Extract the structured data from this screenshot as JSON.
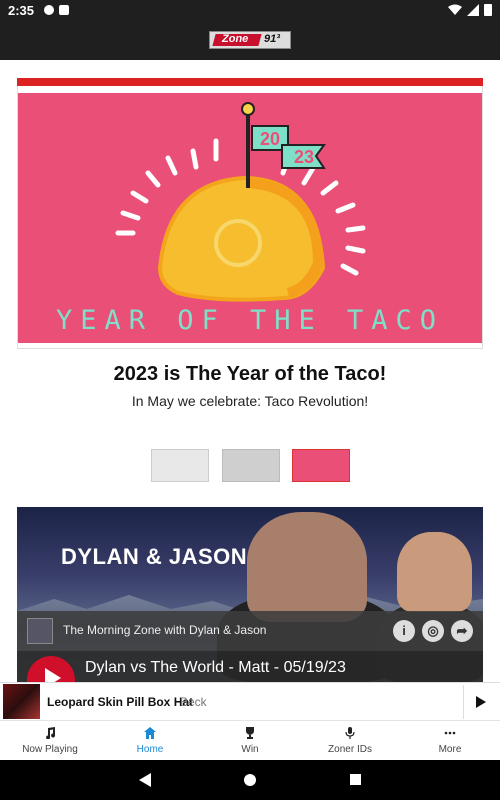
{
  "status_bar": {
    "time": "2:35"
  },
  "app": {
    "logo_text": "Zone",
    "logo_frequency": "91³"
  },
  "hero": {
    "flag_year_top": "20",
    "flag_year_bottom": "23",
    "banner_text": "YEAR OF THE TACO",
    "title": "2023 is The Year of the Taco!",
    "subtitle": "In May we celebrate: Taco Revolution!"
  },
  "carousel": {
    "thumbs": [
      "thumb-1",
      "thumb-2",
      "thumb-3"
    ],
    "active_index": 2
  },
  "show": {
    "title": "DYLAN & JASON",
    "podcast_name": "The Morning Zone with Dylan & Jason",
    "episode_title": "Dylan vs The World - Matt - 05/19/23"
  },
  "now_playing": {
    "song": "Leopard Skin Pill Box Hat",
    "artist": "Beck"
  },
  "tabs": [
    {
      "label": "Now Playing",
      "icon": "music-note-icon"
    },
    {
      "label": "Home",
      "icon": "home-icon"
    },
    {
      "label": "Win",
      "icon": "trophy-icon"
    },
    {
      "label": "Zoner IDs",
      "icon": "microphone-icon"
    },
    {
      "label": "More",
      "icon": "more-dots-icon"
    }
  ],
  "active_tab": "Home",
  "colors": {
    "accent": "#1a8ad4",
    "hero_bg": "#ea4f78",
    "brand_red": "#d0102a",
    "teal": "#7fe0c9"
  }
}
